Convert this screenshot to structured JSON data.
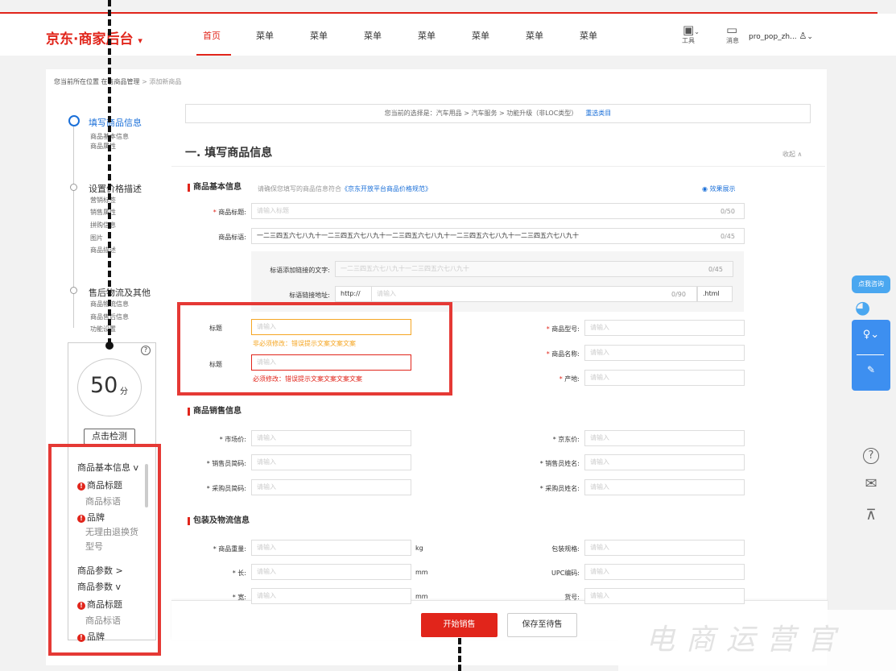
{
  "header": {
    "logo": "京东·商家后台",
    "logo_caret": "▾",
    "nav": [
      "首页",
      "菜单",
      "菜单",
      "菜单",
      "菜单",
      "菜单",
      "菜单",
      "菜单"
    ],
    "tools_label": "工具",
    "message_label": "消息",
    "user": "pro_pop_zh...",
    "user_caret": "⌄"
  },
  "breadcrumb": {
    "prefix": "您当前所在位置",
    "parent": "在售商品管理",
    "sep": ">",
    "current": "添加新商品"
  },
  "left_nav": {
    "steps": [
      {
        "title": "填写商品信息",
        "subs": [
          "商品基本信息",
          "商品属性"
        ]
      },
      {
        "title": "设置价格描述",
        "subs": [
          "营销标签",
          "销售属性",
          "拼购信息",
          "图片",
          "商品描述"
        ]
      },
      {
        "title": "售后物流及其他",
        "subs": [
          "商品物流信息",
          "商品售后信息",
          "功能设置"
        ]
      }
    ]
  },
  "score": {
    "value": "50",
    "unit": "分",
    "help": "?",
    "check_button": "点击检测"
  },
  "checklist": {
    "items": [
      {
        "text": "商品基本信息 v",
        "type": "group"
      },
      {
        "text": "商品标题",
        "type": "error"
      },
      {
        "text": "商品标语",
        "type": "ok"
      },
      {
        "text": "品牌",
        "type": "error"
      },
      {
        "text": "无理由退换货",
        "type": "ok"
      },
      {
        "text": "型号",
        "type": "ok"
      },
      {
        "text": "商品参数   >",
        "type": "group"
      },
      {
        "text": "商品参数   v",
        "type": "group"
      },
      {
        "text": "商品标题",
        "type": "error"
      },
      {
        "text": "商品标语",
        "type": "ok"
      },
      {
        "text": "品牌",
        "type": "error"
      }
    ]
  },
  "selection_bar": {
    "text": "您当前的选择是：汽车用品 > 汽车服务 > 功能升级（非LOC类型）",
    "reselect": "重选类目"
  },
  "section": {
    "title": "一. 填写商品信息",
    "collapse": "收起 ∧"
  },
  "basic_info": {
    "heading": "商品基本信息",
    "hint_prefix": "请确保您填写的商品信息符合",
    "hint_link": "《京东开放平台商品价格规范》",
    "preview": "效果展示",
    "title_label": "* 商品标题:",
    "title_placeholder": "请输入标题",
    "title_count": "0/50",
    "slogan_label": "商品标语:",
    "slogan_value": "一二三四五六七八九十一二三四五六七八九十一二三四五六七八九十一二三四五六七八九十一二三四五六七八九十",
    "slogan_count": "0/45",
    "link_text_label": "标语添加链接的文字:",
    "link_text_value": "一二三四五六七八九十一二三四五六七八九十",
    "link_text_count": "0/45",
    "link_url_label": "标语链接地址:",
    "link_url_prefix": "http://",
    "link_url_placeholder": "请输入",
    "link_url_count": "0/90",
    "link_url_suffix": ".html"
  },
  "demo_fields": {
    "title1_label": "标题",
    "title1_placeholder": "请输入",
    "title1_msg": "非必须修改：错误提示文案文案文案",
    "title2_label": "标题",
    "title2_placeholder": "请输入",
    "title2_msg": "必须修改：错误提示文案文案文案文案"
  },
  "right_fields": [
    {
      "label": "* 商品型号:",
      "placeholder": "请输入"
    },
    {
      "label": "* 商品名称:",
      "placeholder": "请输入"
    },
    {
      "label": "* 产地:",
      "placeholder": "请输入"
    }
  ],
  "sales_info": {
    "heading": "商品销售信息",
    "left": [
      {
        "label": "* 市场价:",
        "placeholder": "请输入"
      },
      {
        "label": "* 销售员简码:",
        "placeholder": "请输入"
      },
      {
        "label": "* 采购员简码:",
        "placeholder": "请输入"
      }
    ],
    "right": [
      {
        "label": "* 京东价:",
        "placeholder": "请输入"
      },
      {
        "label": "* 销售员姓名:",
        "placeholder": "请输入"
      },
      {
        "label": "* 采购员姓名:",
        "placeholder": "请输入"
      }
    ]
  },
  "logistics_info": {
    "heading": "包装及物流信息",
    "left": [
      {
        "label": "* 商品重量:",
        "placeholder": "请输入",
        "unit": "kg"
      },
      {
        "label": "* 长:",
        "placeholder": "请输入",
        "unit": "mm"
      },
      {
        "label": "* 宽:",
        "placeholder": "请输入",
        "unit": "mm"
      }
    ],
    "right": [
      {
        "label": "包装规格:",
        "placeholder": "请输入"
      },
      {
        "label": "UPC编码:",
        "placeholder": "请输入"
      },
      {
        "label": "货号:",
        "placeholder": "请输入"
      }
    ]
  },
  "footer": {
    "start_sale": "开始销售",
    "save_pending": "保存至待售"
  },
  "floating": {
    "consult": "点我咨询",
    "help": "?",
    "mail": "✉",
    "top": "⊼"
  },
  "watermark": "电商运营官",
  "colors": {
    "brand_red": "#e1251b",
    "link_blue": "#1a6fd8",
    "warn_orange": "#f5a623",
    "highlight_box": "#e53935"
  }
}
